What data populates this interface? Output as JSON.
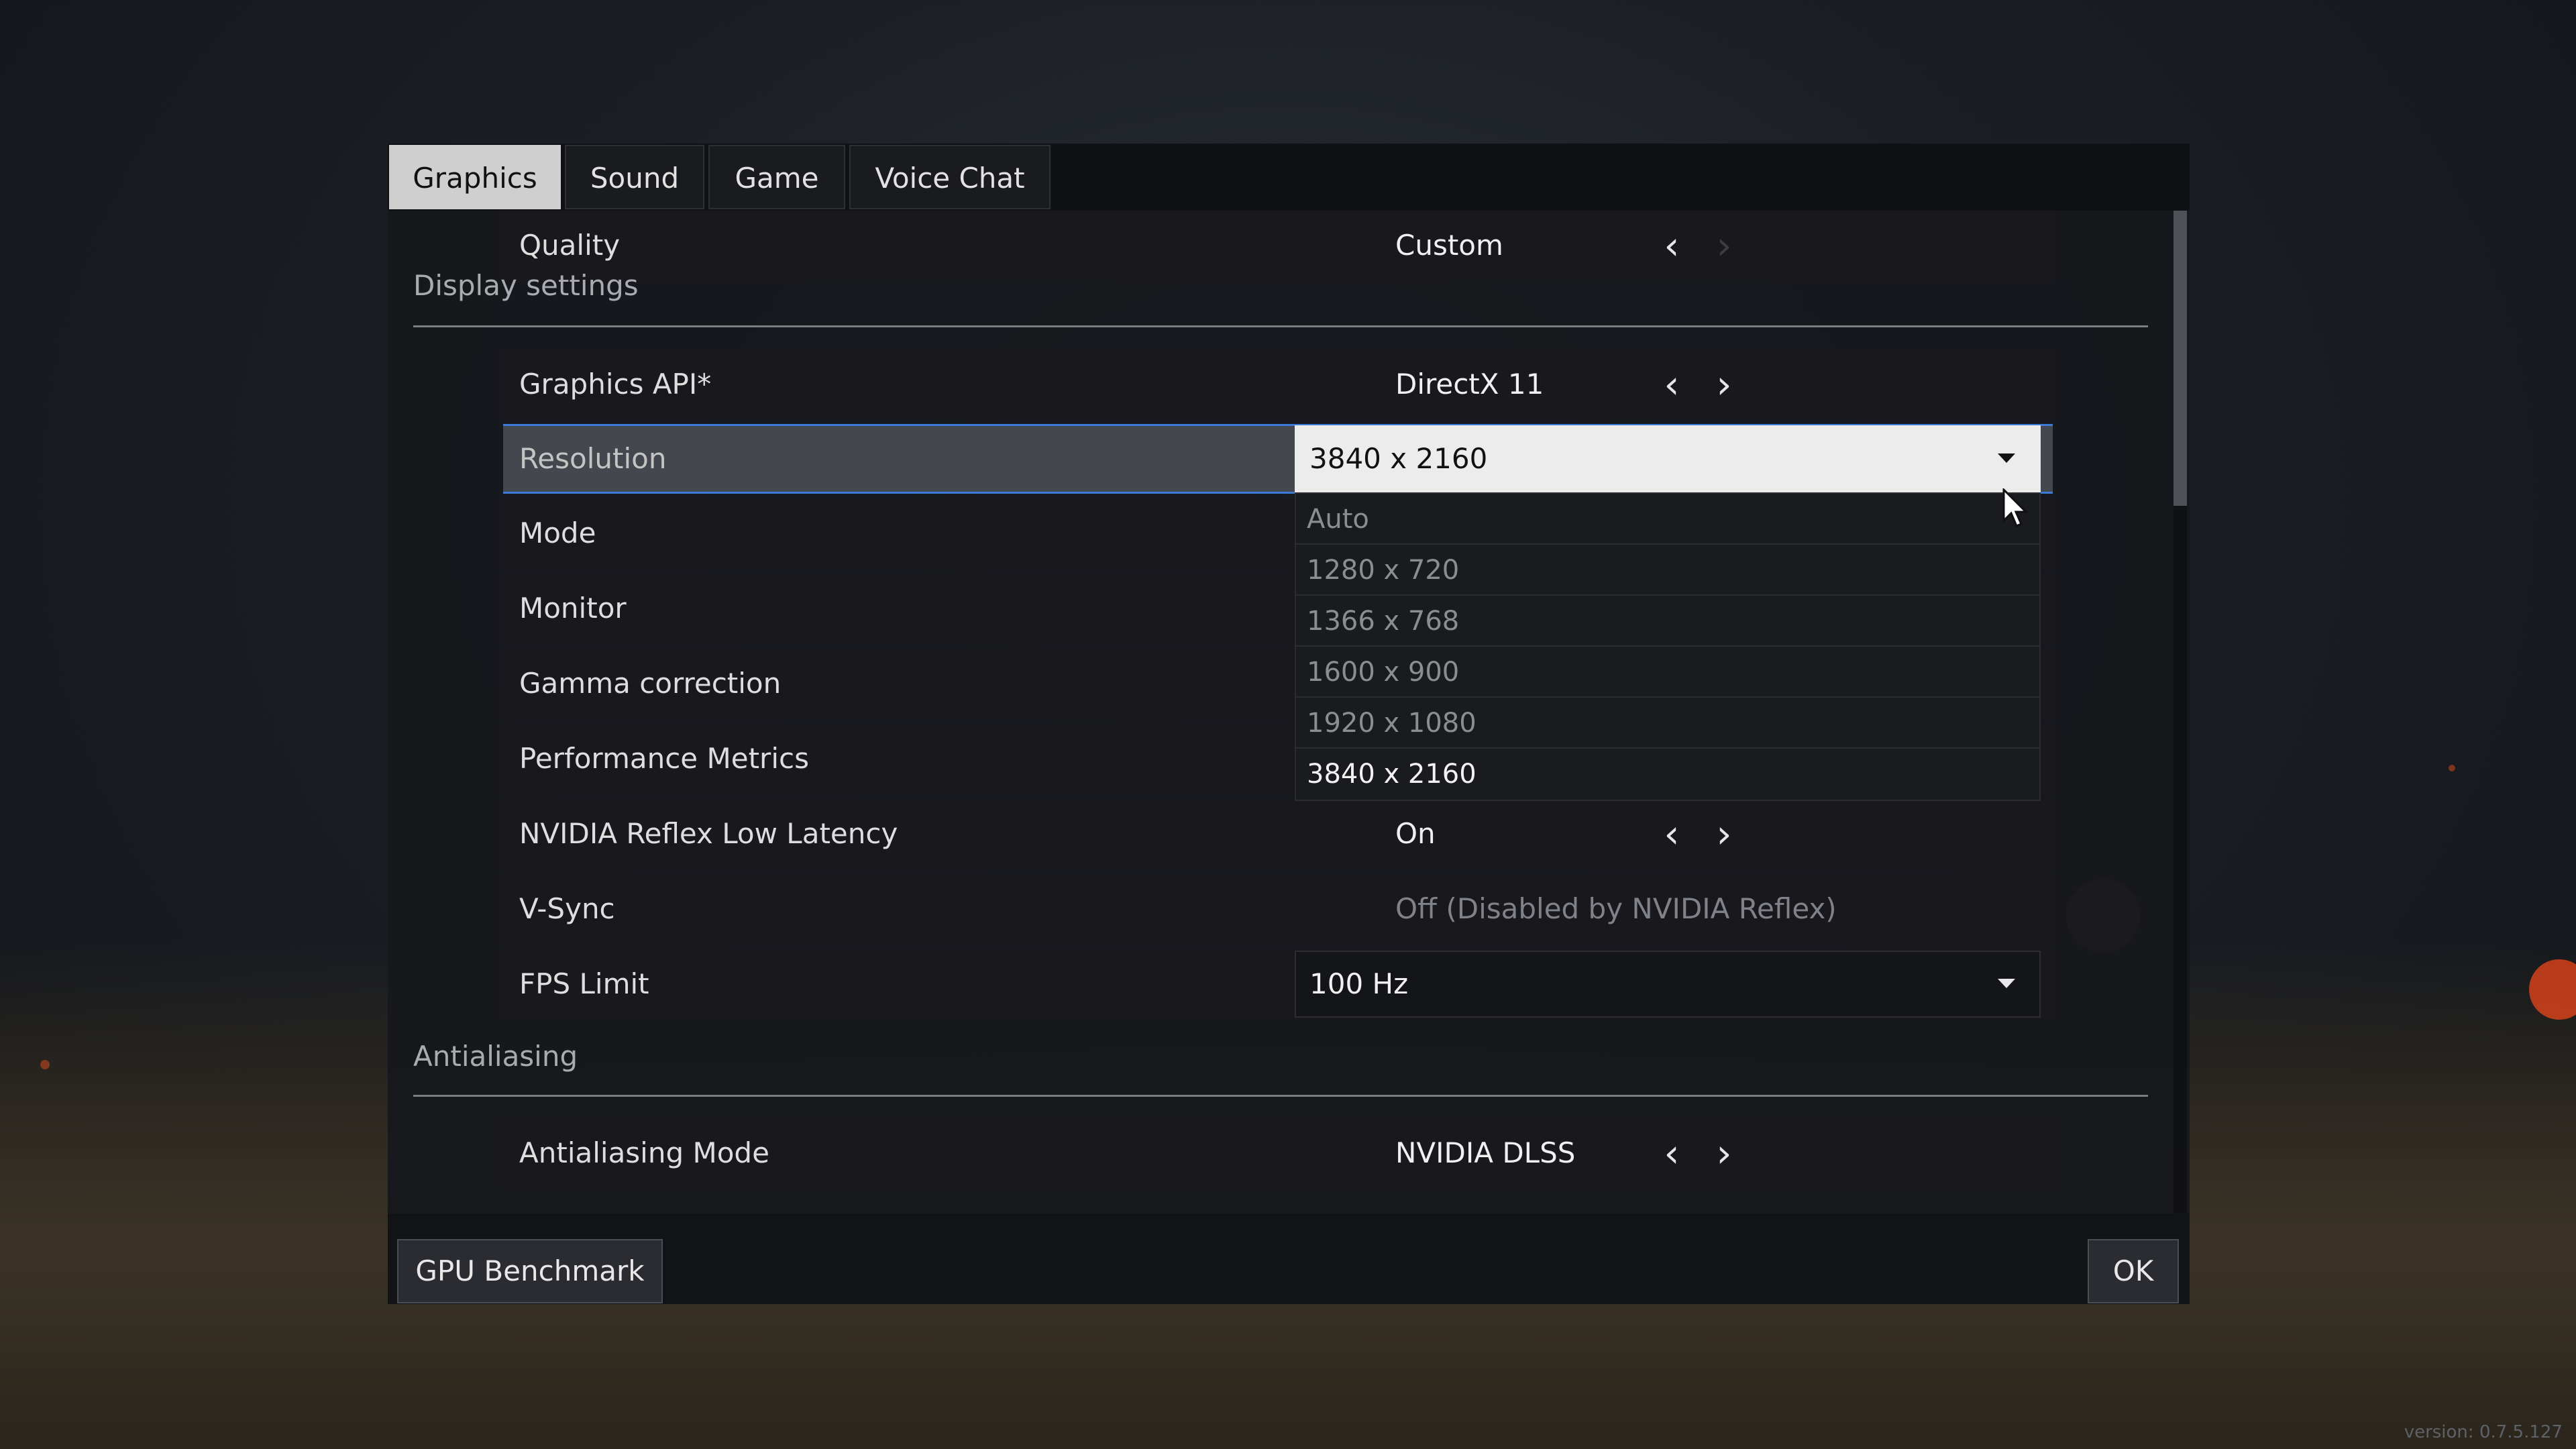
{
  "tabs": [
    {
      "label": "Graphics",
      "active": true
    },
    {
      "label": "Sound"
    },
    {
      "label": "Game"
    },
    {
      "label": "Voice Chat"
    }
  ],
  "quality": {
    "label": "Quality",
    "value": "Custom"
  },
  "sections": {
    "display": "Display settings",
    "antialiasing": "Antialiasing"
  },
  "settings": {
    "graphics_api": {
      "label": "Graphics API*",
      "value": "DirectX 11"
    },
    "resolution": {
      "label": "Resolution",
      "value": "3840 x 2160"
    },
    "mode": {
      "label": "Mode"
    },
    "monitor": {
      "label": "Monitor"
    },
    "gamma": {
      "label": "Gamma correction"
    },
    "performance_metrics": {
      "label": "Performance Metrics"
    },
    "reflex": {
      "label": "NVIDIA Reflex Low Latency",
      "value": "On"
    },
    "vsync": {
      "label": "V-Sync",
      "value": "Off (Disabled by NVIDIA Reflex)"
    },
    "fps_limit": {
      "label": "FPS Limit",
      "value": "100 Hz"
    },
    "aa_mode": {
      "label": "Antialiasing Mode",
      "value": "NVIDIA DLSS"
    }
  },
  "resolution_options": [
    "Auto",
    "1280 x 720",
    "1366 x 768",
    "1600 x 900",
    "1920 x 1080",
    "3840 x 2160"
  ],
  "resolution_selected": "3840 x 2160",
  "footer": {
    "benchmark": "GPU Benchmark",
    "ok": "OK"
  },
  "version": "version: 0.7.5.127",
  "colors": {
    "accent": "#3a7bd5",
    "active_tab": "#cfcfcf",
    "dropdown_open": "#ececec"
  }
}
